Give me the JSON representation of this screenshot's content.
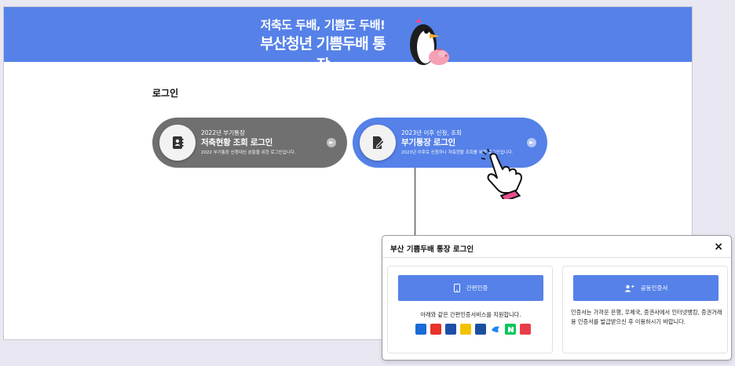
{
  "banner": {
    "line1": "저축도 두배, 기쁨도 두배!",
    "line2": "부산청년 기쁨두배 통장"
  },
  "section": {
    "title": "로그인"
  },
  "cards": [
    {
      "small": "2022년 부기통장",
      "title": "저축현황 조회 로그인",
      "desc": "2022 부기통장 신청대신 분들을 위한 로그인입니다.",
      "color": "#707070"
    },
    {
      "small": "2023년 이후 신청, 조회",
      "title": "부기통장 로그인",
      "desc": "2023년 이후로 신청하나 저축현황 조회를 위한 로그인입니다.",
      "color": "#5581e8"
    }
  ],
  "modal": {
    "title": "부산 기쁨두배 통장 로그인",
    "close": "×",
    "simple_auth": {
      "button": "간편인증",
      "description": "아래와 같은 간편인증서비스를 지원합니다.",
      "providers": [
        {
          "name": "kakao-pay-icon",
          "color": "#1a6ad8"
        },
        {
          "name": "payco-icon",
          "color": "#e8322a"
        },
        {
          "name": "samsung-pass-icon",
          "color": "#1d4fa8"
        },
        {
          "name": "kb-icon",
          "color": "#f2c200"
        },
        {
          "name": "shinhan-icon",
          "color": "#1a4fa0"
        },
        {
          "name": "toss-icon",
          "color": "#1f86f0"
        },
        {
          "name": "naver-icon",
          "color": "#03c75a"
        },
        {
          "name": "pass-icon",
          "color": "#e83e4a"
        }
      ]
    },
    "cert": {
      "button": "공동인증서",
      "description": "인증서는 가까운 은행, 우체국, 증권사에서 인터넷뱅킹, 증권거래용 인증서를 발급받으신 후 이용하시기 바랍니다."
    }
  },
  "colors": {
    "accent": "#5581e8",
    "gray_card": "#707070",
    "hand_cuff": "#e8508f"
  }
}
